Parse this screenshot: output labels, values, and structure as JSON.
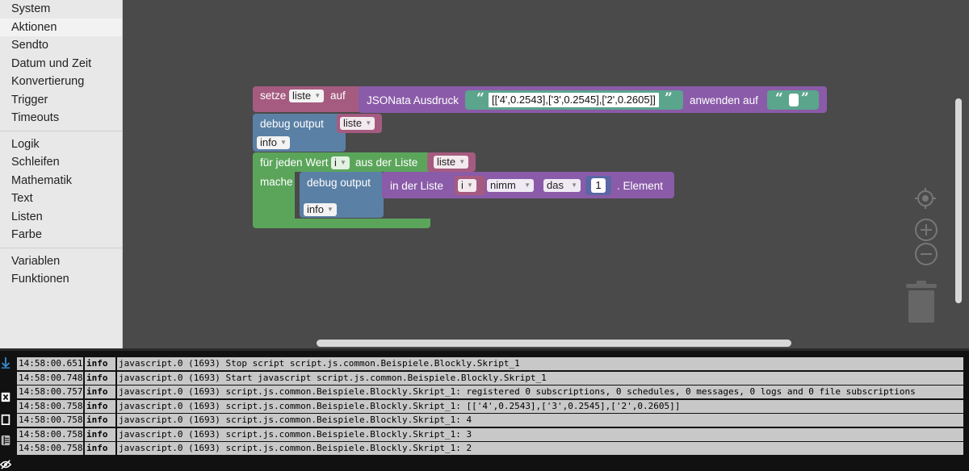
{
  "toolbox": {
    "groups": [
      [
        "System",
        "Aktionen",
        "Sendto",
        "Datum und Zeit",
        "Konvertierung",
        "Trigger",
        "Timeouts"
      ],
      [
        "Logik",
        "Schleifen",
        "Mathematik",
        "Text",
        "Listen",
        "Farbe"
      ],
      [
        "Variablen",
        "Funktionen"
      ]
    ],
    "selected": "Aktionen"
  },
  "blocks": {
    "set": {
      "label": "setze",
      "var": "liste",
      "to": "auf"
    },
    "jsonata": {
      "label": "JSONata Ausdruck",
      "expression": "[['4',0.2543],['3',0.2545],['2',0.2605]]",
      "apply": "anwenden auf",
      "input": ""
    },
    "debug1": {
      "label": "debug output",
      "var": "liste",
      "level": "info"
    },
    "foreach": {
      "label": "für jeden Wert",
      "var": "i",
      "from": "aus der Liste",
      "list": "liste",
      "do": "mache"
    },
    "debug2": {
      "label": "debug output",
      "level": "info"
    },
    "getitem": {
      "label": "in der Liste",
      "var": "i",
      "mode": "nimm",
      "where": "das",
      "index": "1",
      "suffix": ". Element"
    }
  },
  "colors": {
    "variables": "#a55b80",
    "purple": "#8a5ba8",
    "debug": "#5b80a5",
    "loop": "#5ba55b",
    "text": "#5ba58c"
  },
  "log": {
    "rows": [
      {
        "time": "14:58:00.651",
        "level": "info",
        "msg": "javascript.0 (1693) Stop script script.js.common.Beispiele.Blockly.Skript_1"
      },
      {
        "time": "14:58:00.748",
        "level": "info",
        "msg": "javascript.0 (1693) Start javascript script.js.common.Beispiele.Blockly.Skript_1"
      },
      {
        "time": "14:58:00.757",
        "level": "info",
        "msg": "javascript.0 (1693) script.js.common.Beispiele.Blockly.Skript_1: registered 0 subscriptions, 0 schedules, 0 messages, 0 logs and 0 file subscriptions"
      },
      {
        "time": "14:58:00.758",
        "level": "info",
        "msg": "javascript.0 (1693) script.js.common.Beispiele.Blockly.Skript_1: [['4',0.2543],['3',0.2545],['2',0.2605]]"
      },
      {
        "time": "14:58:00.758",
        "level": "info",
        "msg": "javascript.0 (1693) script.js.common.Beispiele.Blockly.Skript_1: 4"
      },
      {
        "time": "14:58:00.758",
        "level": "info",
        "msg": "javascript.0 (1693) script.js.common.Beispiele.Blockly.Skript_1: 3"
      },
      {
        "time": "14:58:00.758",
        "level": "info",
        "msg": "javascript.0 (1693) script.js.common.Beispiele.Blockly.Skript_1: 2"
      }
    ]
  },
  "icons": [
    "arrow-down-icon",
    "clear-log-icon",
    "copy-icon",
    "columns-icon",
    "hide-icon",
    "target-icon",
    "zoom-in-icon",
    "zoom-out-icon",
    "trash-icon"
  ]
}
